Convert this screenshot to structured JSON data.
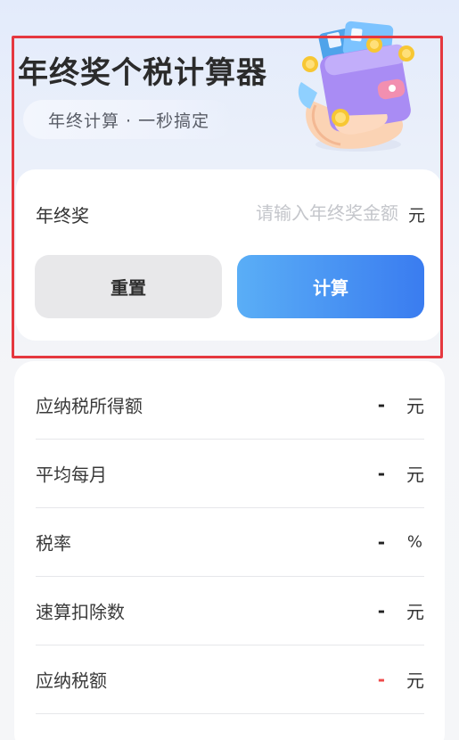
{
  "header": {
    "title": "年终奖个税计算器",
    "subtitle": "年终计算 · 一秒搞定"
  },
  "input": {
    "label": "年终奖",
    "placeholder": "请输入年终奖金额",
    "value": "",
    "unit": "元"
  },
  "buttons": {
    "reset_label": "重置",
    "calculate_label": "计算"
  },
  "results": [
    {
      "label": "应纳税所得额",
      "value": "-",
      "unit": "元",
      "highlight": false
    },
    {
      "label": "平均每月",
      "value": "-",
      "unit": "元",
      "highlight": false
    },
    {
      "label": "税率",
      "value": "-",
      "unit": "%",
      "highlight": false
    },
    {
      "label": "速算扣除数",
      "value": "-",
      "unit": "元",
      "highlight": false
    },
    {
      "label": "应纳税额",
      "value": "-",
      "unit": "元",
      "highlight": true
    }
  ],
  "colors": {
    "accent_start": "#5aaef6",
    "accent_end": "#3a7cf0",
    "highlight_value": "#ef4a4a",
    "selection_frame": "#e5383f"
  },
  "icons": {
    "illustration": "wallet-hand-coins-illustration"
  }
}
